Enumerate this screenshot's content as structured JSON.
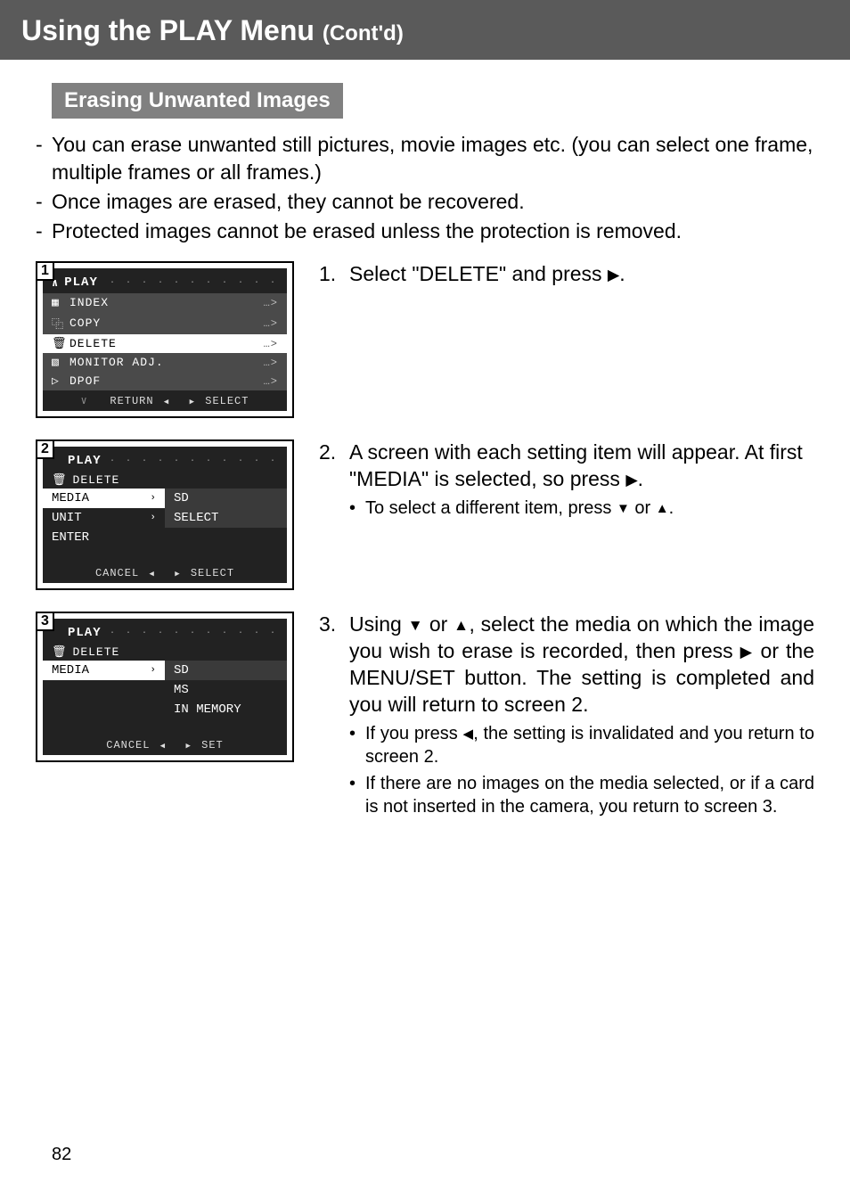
{
  "header": {
    "title": "Using the PLAY Menu",
    "sub": "(Cont'd)"
  },
  "section_title": "Erasing Unwanted Images",
  "intro": [
    "You can erase unwanted still pictures, movie images etc. (you can select one frame, multiple frames or all frames.)",
    "Once images are erased, they cannot be recovered.",
    "Protected images cannot be erased unless the protection is removed."
  ],
  "steps": [
    {
      "num": "1",
      "screenshot": {
        "title": "PLAY",
        "rows": [
          {
            "icon": "▦",
            "label": "INDEX",
            "arr": "…>"
          },
          {
            "icon": "⿻",
            "label": "COPY",
            "arr": "…>"
          },
          {
            "icon": "🗑",
            "label": "DELETE",
            "arr": "…>",
            "sel": true
          },
          {
            "icon": "▧",
            "label": "MONITOR ADJ.",
            "arr": "…>"
          },
          {
            "icon": "▷",
            "label": "DPOF",
            "arr": "…>"
          }
        ],
        "foot_left": "RETURN",
        "foot_right": "SELECT"
      },
      "text_num": "1.",
      "text_main_pre": "Select \"DELETE\" and press ",
      "text_main_post": ".",
      "bullets": []
    },
    {
      "num": "2",
      "screenshot": {
        "title": "PLAY",
        "subhead_icon": "🗑",
        "subhead": "DELETE",
        "pairs": [
          {
            "left": "MEDIA",
            "right": "SD",
            "sel": true
          },
          {
            "left": "UNIT",
            "right": "SELECT"
          },
          {
            "left": "ENTER",
            "right": ""
          }
        ],
        "foot_left": "CANCEL",
        "foot_right": "SELECT"
      },
      "text_num": "2.",
      "text_main_a": "A screen with each setting item will appear. At first \"MEDIA\" is selected, so press ",
      "text_main_b": ".",
      "bullets": [
        {
          "pre": "To select a different item, press ",
          "mid": " or ",
          "post": "."
        }
      ]
    },
    {
      "num": "3",
      "screenshot": {
        "title": "PLAY",
        "subhead_icon": "🗑",
        "subhead": "DELETE",
        "pairs": [
          {
            "left": "MEDIA",
            "right": "SD",
            "sel": true
          },
          {
            "left": "",
            "right": "MS"
          },
          {
            "left": "",
            "right": "IN MEMORY"
          }
        ],
        "foot_left": "CANCEL",
        "foot_right": "SET"
      },
      "text_num": "3.",
      "text3_a": "Using ",
      "text3_b": " or ",
      "text3_c": ", select the media on which the image you wish to erase is recorded, then press ",
      "text3_d": " or the MENU/SET button. The setting is completed and you will return to screen 2.",
      "bullets3": [
        {
          "pre": "If you press ",
          "post": ", the setting is invalidated and you return to screen 2."
        },
        {
          "text": "If there are no images on the media selected, or if a card is not inserted in the camera, you return to screen 3."
        }
      ]
    }
  ],
  "page_number": "82"
}
